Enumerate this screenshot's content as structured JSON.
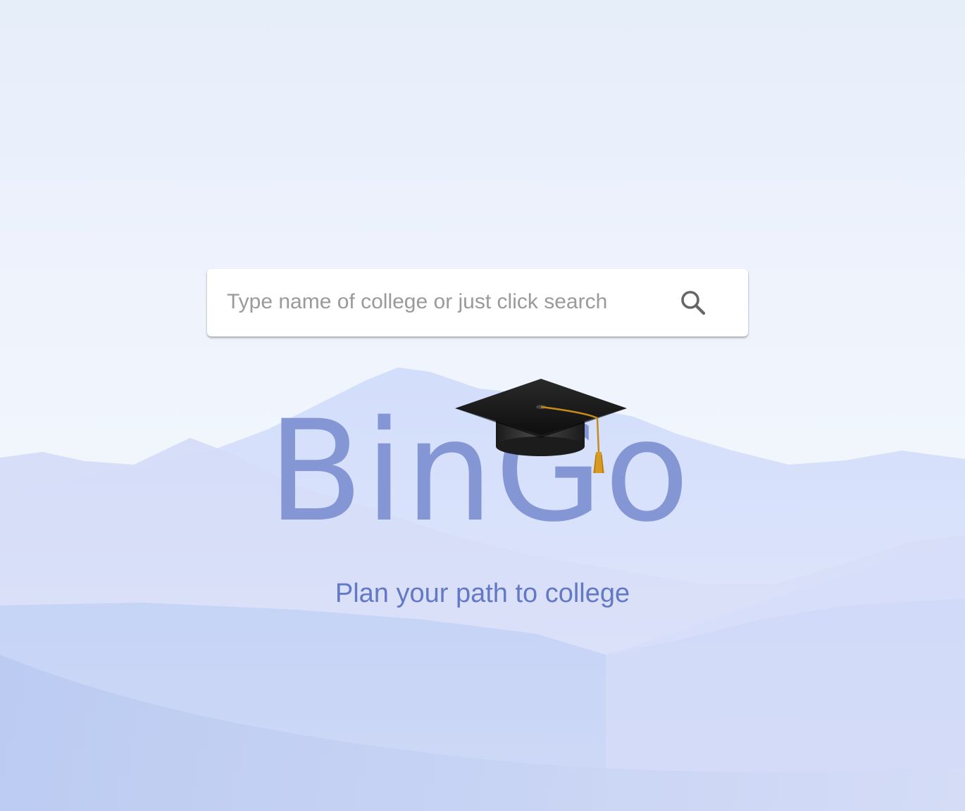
{
  "search": {
    "placeholder": "Type name of college or just click search",
    "value": "",
    "button_icon": "search-icon"
  },
  "logo": {
    "text": "BinGo",
    "icon": "graduation-cap-icon",
    "color": "#8497d4"
  },
  "tagline": {
    "text": "Plan your path to college",
    "color": "#6379c5"
  },
  "theme": {
    "background_top": "#e6eefa",
    "mountain_color": "#c9d5f5"
  }
}
